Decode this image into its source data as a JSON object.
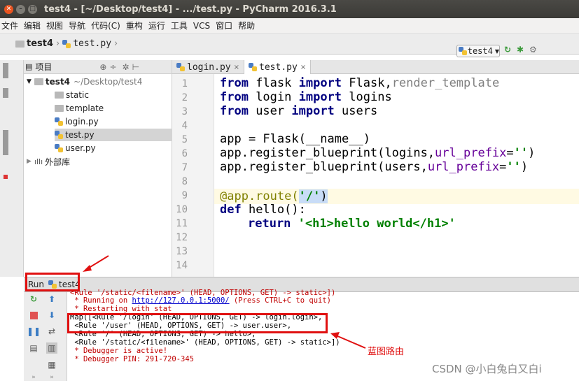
{
  "window": {
    "title": "test4 - [~/Desktop/test4] - .../test.py - PyCharm 2016.3.1"
  },
  "menu": [
    "文件",
    "编辑",
    "视图",
    "导航",
    "代码(C)",
    "重构",
    "运行",
    "工具",
    "VCS",
    "窗口",
    "帮助"
  ],
  "breadcrumb": {
    "project": "test4",
    "file": "test.py"
  },
  "run_config": {
    "label": "test4"
  },
  "project_panel": {
    "header": "项目",
    "root_name": "test4",
    "root_path": "~/Desktop/test4",
    "items": [
      "static",
      "template",
      "login.py",
      "test.py",
      "user.py"
    ],
    "external": "外部库"
  },
  "editor": {
    "tabs": [
      "login.py",
      "test.py"
    ],
    "line_numbers": [
      "1",
      "2",
      "3",
      "4",
      "5",
      "6",
      "7",
      "8",
      "9",
      "10",
      "11",
      "12",
      "13",
      "14"
    ],
    "code": {
      "l1": {
        "kw1": "from",
        "mod": " flask ",
        "kw2": "import",
        "rest": " Flask,",
        "gray": "render_template"
      },
      "l2": {
        "kw1": "from",
        "mod": " login ",
        "kw2": "import",
        "rest": " logins"
      },
      "l3": {
        "kw1": "from",
        "mod": " user ",
        "kw2": "import",
        "rest": " users"
      },
      "l5": {
        "text": "app = Flask(__name__)"
      },
      "l6": {
        "pre": "app.register_blueprint(logins,",
        "param": "url_prefix",
        "eq": "=",
        "str": "''",
        "close": ")"
      },
      "l7": {
        "pre": "app.register_blueprint(users,",
        "param": "url_prefix",
        "eq": "=",
        "str": "''",
        "close": ")"
      },
      "l9": {
        "dec": "@app.route(",
        "str": "'/'",
        "close": ")"
      },
      "l10": {
        "kw": "def",
        "rest": " hello():"
      },
      "l11": {
        "kw": "return",
        "str": " '<h1>hello world</h1>'"
      }
    }
  },
  "run_panel": {
    "label": "Run",
    "config": "test4"
  },
  "console": {
    "line0": "<Rule '/static/<filename>' (HEAD, OPTIONS, GET) -> static>])",
    "line1_pre": " * Running on ",
    "line1_link": "http://127.0.0.1:5000/",
    "line1_post": " (Press CTRL+C to quit)",
    "line2": " * Restarting with stat",
    "line3": "Map([<Rule '/login' (HEAD, OPTIONS, GET) -> login.login>,",
    "line4": " <Rule '/user' (HEAD, OPTIONS, GET) -> user.user>,",
    "line5": " <Rule '/' (HEAD, OPTIONS, GET) -> hello>,",
    "line6": " <Rule '/static/<filename>' (HEAD, OPTIONS, GET) -> static>])",
    "line7": " * Debugger is active!",
    "line8": " * Debugger PIN: 291-720-345"
  },
  "annotation": {
    "label": "蓝图路由",
    "color": "#e01010"
  },
  "watermark": "CSDN @小白兔白又白i"
}
